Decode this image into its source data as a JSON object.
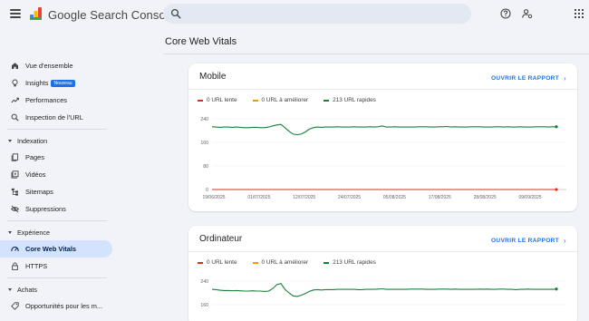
{
  "header": {
    "app_name": "Google Search Console",
    "search_placeholder": ""
  },
  "sidebar": {
    "items": [
      {
        "label": "Vue d'ensemble",
        "icon": "home-icon"
      },
      {
        "label": "Insights",
        "icon": "lightbulb-icon",
        "badge": "Nouveau"
      },
      {
        "label": "Performances",
        "icon": "trending-up-icon"
      },
      {
        "label": "Inspection de l'URL",
        "icon": "search-icon"
      }
    ],
    "sections": [
      {
        "label": "Indexation",
        "items": [
          {
            "label": "Pages",
            "icon": "pages-icon"
          },
          {
            "label": "Vidéos",
            "icon": "video-icon"
          },
          {
            "label": "Sitemaps",
            "icon": "sitemap-icon"
          },
          {
            "label": "Suppressions",
            "icon": "visibility-off-icon"
          }
        ]
      },
      {
        "label": "Expérience",
        "items": [
          {
            "label": "Core Web Vitals",
            "icon": "speed-icon",
            "active": true
          },
          {
            "label": "HTTPS",
            "icon": "lock-icon"
          }
        ]
      },
      {
        "label": "Achats",
        "items": [
          {
            "label": "Opportunités pour les m...",
            "icon": "tag-icon"
          }
        ]
      }
    ]
  },
  "main": {
    "title": "Core Web Vitals",
    "cards": [
      {
        "title": "Mobile",
        "link": "OUVRIR LE RAPPORT",
        "legend": [
          {
            "label": "0 URL lente",
            "color": "#d93025"
          },
          {
            "label": "0 URL à améliorer",
            "color": "#f29900"
          },
          {
            "label": "213 URL rapides",
            "color": "#188038"
          }
        ]
      },
      {
        "title": "Ordinateur",
        "link": "OUVRIR LE RAPPORT",
        "legend": [
          {
            "label": "0 URL lente",
            "color": "#d93025"
          },
          {
            "label": "0 URL à améliorer",
            "color": "#f29900"
          },
          {
            "label": "213 URL rapides",
            "color": "#188038"
          }
        ]
      }
    ]
  },
  "colors": {
    "accent": "#1a73e8",
    "active_nav_bg": "#d3e3fd",
    "slow": "#d93025",
    "improve": "#f29900",
    "fast": "#188038"
  },
  "chart_data": [
    {
      "type": "line",
      "title": "Mobile",
      "ylim": [
        0,
        240
      ],
      "yticks": [
        "240",
        "160",
        "80",
        "0"
      ],
      "x_tick_labels": [
        "19/06/2025",
        "01/07/2025",
        "12/07/2025",
        "24/07/2025",
        "05/08/2025",
        "17/08/2025",
        "28/08/2025",
        "09/09/2025"
      ],
      "series": [
        {
          "name": "0 URL lente",
          "color": "#d93025",
          "values": [
            0,
            0,
            0,
            0,
            0,
            0,
            0,
            0,
            0,
            0,
            0,
            0,
            0,
            0,
            0,
            0,
            0,
            0,
            0,
            0,
            0,
            0,
            0,
            0,
            0,
            0,
            0,
            0,
            0,
            0,
            0,
            0,
            0,
            0,
            0,
            0,
            0,
            0,
            0,
            0,
            0,
            0,
            0,
            0,
            0,
            0,
            0,
            0,
            0,
            0,
            0,
            0,
            0,
            0,
            0,
            0,
            0,
            0,
            0,
            0,
            0,
            0,
            0,
            0,
            0,
            0,
            0,
            0,
            0,
            0,
            0,
            0,
            0,
            0,
            0,
            0,
            0,
            0,
            0,
            0,
            0,
            0,
            0,
            0,
            0,
            0
          ]
        },
        {
          "name": "0 URL à améliorer",
          "color": "#f29900",
          "values": [
            0,
            0,
            0,
            0,
            0,
            0,
            0,
            0,
            0,
            0,
            0,
            0,
            0,
            0,
            0,
            0,
            0,
            0,
            0,
            0,
            0,
            0,
            0,
            0,
            0,
            0,
            0,
            0,
            0,
            0,
            0,
            0,
            0,
            0,
            0,
            0,
            0,
            0,
            0,
            0,
            0,
            0,
            0,
            0,
            0,
            0,
            0,
            0,
            0,
            0,
            0,
            0,
            0,
            0,
            0,
            0,
            0,
            0,
            0,
            0,
            0,
            0,
            0,
            0,
            0,
            0,
            0,
            0,
            0,
            0,
            0,
            0,
            0,
            0,
            0,
            0,
            0,
            0,
            0,
            0,
            0,
            0,
            0,
            0,
            0,
            0
          ]
        },
        {
          "name": "213 URL rapides",
          "color": "#188038",
          "values": [
            213,
            212,
            211,
            212,
            212,
            211,
            212,
            211,
            210,
            210,
            211,
            211,
            210,
            210,
            212,
            216,
            219,
            221,
            210,
            198,
            188,
            186,
            188,
            195,
            205,
            210,
            212,
            211,
            212,
            212,
            212,
            213,
            212,
            212,
            212,
            213,
            212,
            212,
            212,
            213,
            212,
            213,
            216,
            212,
            212,
            213,
            212,
            212,
            212,
            212,
            212,
            213,
            213,
            213,
            212,
            212,
            213,
            213,
            214,
            212,
            213,
            212,
            212,
            212,
            213,
            213,
            213,
            212,
            212,
            212,
            213,
            213,
            212,
            213,
            212,
            212,
            213,
            212,
            212,
            212,
            213,
            213,
            213,
            212,
            213,
            213
          ]
        }
      ]
    },
    {
      "type": "line",
      "title": "Ordinateur",
      "ylim": [
        0,
        240
      ],
      "yticks": [
        "240",
        "160"
      ],
      "series": [
        {
          "name": "0 URL lente",
          "color": "#d93025",
          "values": []
        },
        {
          "name": "0 URL à améliorer",
          "color": "#f29900",
          "values": []
        },
        {
          "name": "213 URL rapides",
          "color": "#188038",
          "values": [
            212,
            211,
            209,
            208,
            208,
            207,
            208,
            207,
            206,
            206,
            207,
            206,
            206,
            205,
            206,
            215,
            228,
            232,
            212,
            200,
            190,
            188,
            192,
            198,
            205,
            210,
            211,
            210,
            211,
            211,
            211,
            212,
            212,
            212,
            212,
            212,
            211,
            211,
            212,
            212,
            212,
            213,
            214,
            212,
            212,
            212,
            212,
            212,
            212,
            213,
            213,
            213,
            213,
            212,
            212,
            212,
            213,
            213,
            213,
            212,
            213,
            212,
            212,
            212,
            212,
            212,
            213,
            212,
            213,
            212,
            212,
            213,
            213,
            212,
            212,
            211,
            212,
            212,
            213,
            212,
            212,
            212,
            212,
            212,
            212,
            213
          ]
        }
      ]
    }
  ]
}
